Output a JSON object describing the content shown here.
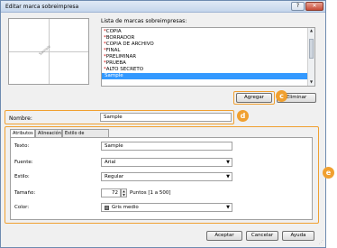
{
  "window": {
    "title": "Editar marca sobreimpresa",
    "help": "?",
    "close": "✕"
  },
  "preview": {
    "watermark_text": "Sample"
  },
  "list": {
    "label": "Lista de marcas sobreimpresas:",
    "items": [
      {
        "star": "*",
        "text": "COPIA"
      },
      {
        "star": "*",
        "text": "BORRADOR"
      },
      {
        "star": "*",
        "text": "COPIA DE ARCHIVO"
      },
      {
        "star": "*",
        "text": "FINAL"
      },
      {
        "star": "*",
        "text": "PRELIMINAR"
      },
      {
        "star": "*",
        "text": "PRUEBA"
      },
      {
        "star": "*",
        "text": "ALTO SECRETO"
      },
      {
        "star": "",
        "text": "Sample"
      }
    ]
  },
  "buttons": {
    "add": "Agregar",
    "delete": "Eliminar",
    "ok": "Aceptar",
    "cancel": "Cancelar",
    "help": "Ayuda"
  },
  "callouts": {
    "c": "c",
    "d": "d",
    "e": "e"
  },
  "name": {
    "label": "Nombre:",
    "value": "Sample"
  },
  "tabs": [
    "Atributos",
    "Alineación",
    "Estilo de impresión"
  ],
  "fields": {
    "text": {
      "label": "Texto:",
      "value": "Sample"
    },
    "font": {
      "label": "Fuente:",
      "value": "Arial"
    },
    "style": {
      "label": "Estilo:",
      "value": "Regular"
    },
    "size": {
      "label": "Tamaño:",
      "value": "72",
      "range": "Puntos [1 a 500]"
    },
    "color": {
      "label": "Color:",
      "value": "Gris medio"
    }
  },
  "colors": {
    "accent": "#f0a030",
    "selection": "#3399ff",
    "star": "#d40000"
  }
}
